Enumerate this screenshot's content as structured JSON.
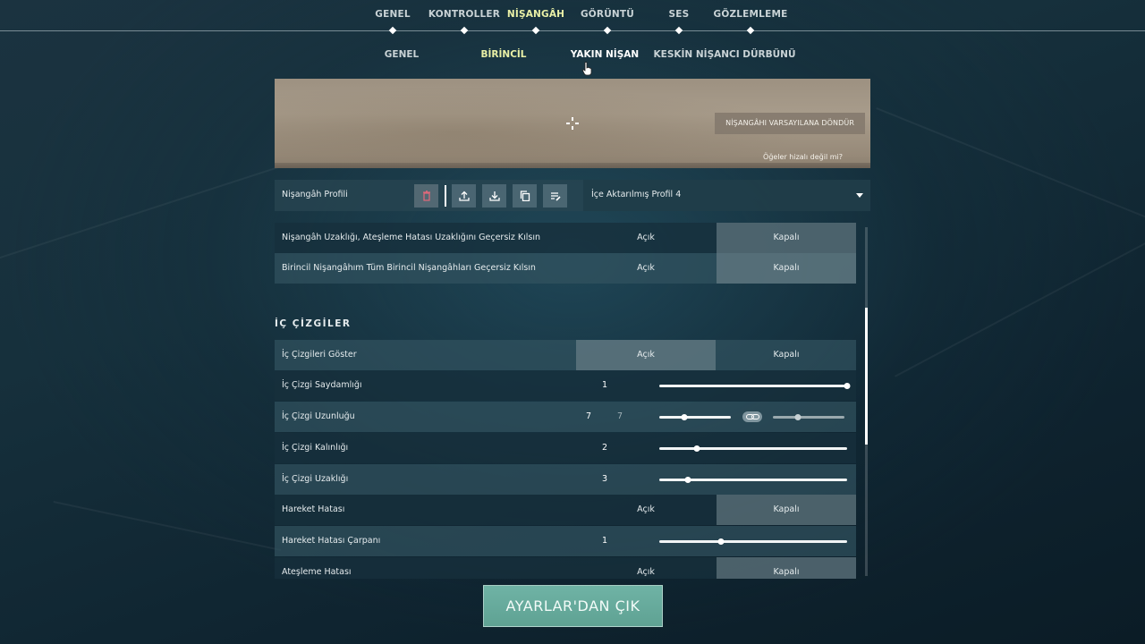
{
  "nav": {
    "tabs": [
      {
        "label": "GENEL"
      },
      {
        "label": "KONTROLLER"
      },
      {
        "label": "NİŞANGÂH"
      },
      {
        "label": "GÖRÜNTÜ"
      },
      {
        "label": "SES"
      },
      {
        "label": "GÖZLEMLEME"
      }
    ],
    "active_tab": "NİŞANGÂH"
  },
  "subnav": {
    "tabs": [
      {
        "label": "GENEL"
      },
      {
        "label": "BİRİNCİL"
      },
      {
        "label": "YAKIN NİŞAN"
      },
      {
        "label": "KESKİN NİŞANCI DÜRBÜNÜ"
      }
    ],
    "active_tab": "BİRİNCİL"
  },
  "preview": {
    "reset_label": "NİŞANGÂHI VARSAYILANA DÖNDÜR",
    "align_link": "Öğeler hizalı değil mi?"
  },
  "profile": {
    "label": "Nişangâh Profili",
    "selected": "İçe Aktarılmış Profil 4",
    "icons": [
      "delete-icon",
      "upload-icon",
      "download-icon",
      "copy-icon",
      "rename-icon"
    ]
  },
  "settings": {
    "override_distance": {
      "label": "Nişangâh Uzaklığı, Ateşleme Hatası Uzaklığını Geçersiz Kılsın",
      "on": "Açık",
      "off": "Kapalı",
      "value": "Kapalı"
    },
    "override_all": {
      "label": "Birincil Nişangâhım Tüm Birincil Nişangâhları Geçersiz Kılsın",
      "on": "Açık",
      "off": "Kapalı",
      "value": "Kapalı"
    }
  },
  "inner_lines": {
    "section_title": "İÇ ÇİZGİLER",
    "show": {
      "label": "İç Çizgileri Göster",
      "on": "Açık",
      "off": "Kapalı",
      "value": "Açık"
    },
    "opacity": {
      "label": "İç Çizgi Saydamlığı",
      "value": "1",
      "fraction": 1.0
    },
    "length": {
      "label": "İç Çizgi Uzunluğu",
      "value": "7",
      "value2": "7",
      "fraction": 0.35,
      "fraction2": 0.35
    },
    "thickness": {
      "label": "İç Çizgi Kalınlığı",
      "value": "2",
      "fraction": 0.2
    },
    "offset": {
      "label": "İç Çizgi Uzaklığı",
      "value": "3",
      "fraction": 0.15
    },
    "movement_error": {
      "label": "Hareket Hatası",
      "on": "Açık",
      "off": "Kapalı",
      "value": "Kapalı"
    },
    "movement_multiplier": {
      "label": "Hareket Hatası Çarpanı",
      "value": "1",
      "fraction": 0.33
    },
    "firing_error": {
      "label": "Ateşleme Hatası",
      "on": "Açık",
      "off": "Kapalı",
      "value": "Kapalı"
    }
  },
  "exit": {
    "label": "AYARLAR'DAN ÇIK"
  }
}
